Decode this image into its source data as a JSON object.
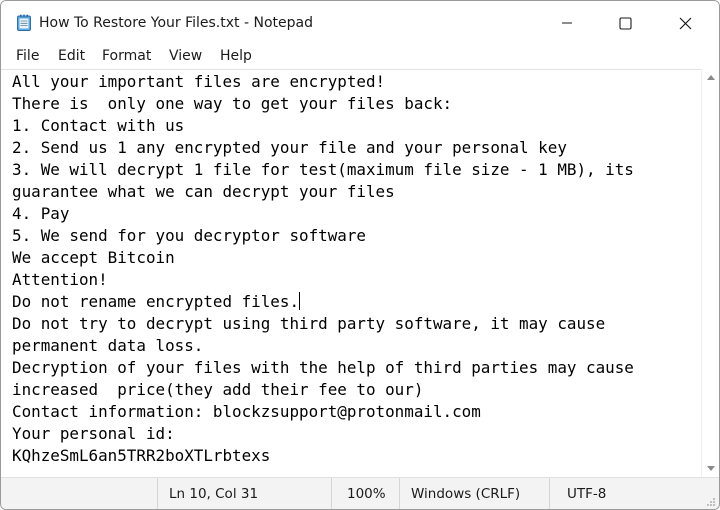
{
  "window": {
    "title": "How To Restore Your Files.txt - Notepad"
  },
  "menu": {
    "file": "File",
    "edit": "Edit",
    "format": "Format",
    "view": "View",
    "help": "Help"
  },
  "document": {
    "lines": [
      "All your important files are encrypted!",
      "There is  only one way to get your files back:",
      "1. Contact with us",
      "2. Send us 1 any encrypted your file and your personal key",
      "3. We will decrypt 1 file for test(maximum file size - 1 MB), its",
      "guarantee what we can decrypt your files",
      "4. Pay",
      "5. We send for you decryptor software",
      "We accept Bitcoin",
      "Attention!",
      "Do not rename encrypted files.",
      "Do not try to decrypt using third party software, it may cause",
      "permanent data loss.",
      "Decryption of your files with the help of third parties may cause",
      "increased  price(they add their fee to our)",
      "Contact information: blockzsupport@protonmail.com",
      "Your personal id:",
      "KQhzeSmL6an5TRR2boXTLrbtexs"
    ],
    "caret_line": 10
  },
  "status": {
    "position": "Ln 10, Col 31",
    "zoom": "100%",
    "line_endings": "Windows (CRLF)",
    "encoding": "UTF-8"
  },
  "icons": {
    "app": "notepad-icon",
    "minimize": "minimize-icon",
    "maximize": "maximize-icon",
    "close": "close-icon"
  }
}
